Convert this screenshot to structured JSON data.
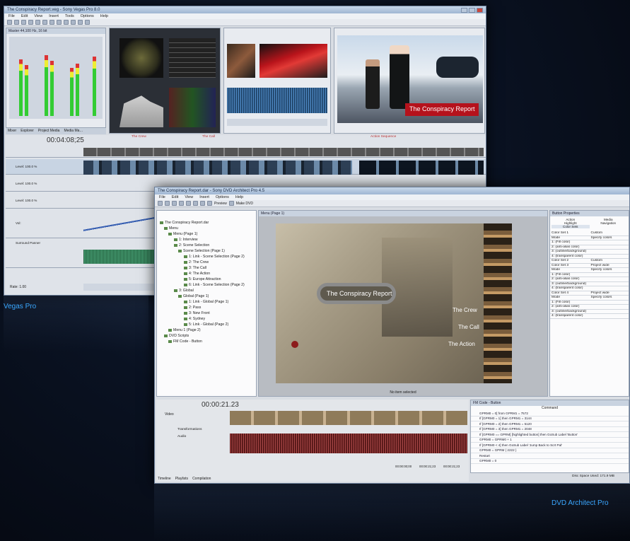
{
  "labels": {
    "vegas": "Vegas Pro",
    "dvda": "DVD Architect Pro"
  },
  "vegas": {
    "title": "The Conspiracy Report.veg - Sony Vegas Pro 8.0",
    "menu": [
      "File",
      "Edit",
      "View",
      "Insert",
      "Tools",
      "Options",
      "Help"
    ],
    "mixer_label": "Master 44,100 Hz, 16 bit",
    "tabs": [
      "Mixer",
      "Explorer",
      "Project Media",
      "Media Ma…"
    ],
    "timecode": "00:04:08;25",
    "preview_title": "The Conspiracy Report",
    "level1": "Level: 100.0 %",
    "level2": "Level: 100.0 %",
    "level3": "Level: 100.0 %",
    "vol": "Vol:",
    "surround": "Surround Panner",
    "rate": "Rate: 1.00",
    "markers": [
      "The Crew",
      "The Call",
      "Action Sequence"
    ]
  },
  "dvda": {
    "title": "The Conspiracy Report.dar - Sony DVD Architect Pro 4.5",
    "menu": [
      "File",
      "Edit",
      "View",
      "Insert",
      "Options",
      "Help"
    ],
    "preview_btn": "Preview",
    "make_dvd_btn": "Make DVD",
    "menu_tab": "Menu (Page 1)",
    "timecode": "00:00:21.23",
    "no_selection": "No item selected",
    "menu_title_text": "The Conspiracy Report",
    "menu_items": [
      "The Crew",
      "The Call",
      "The Action"
    ],
    "tree": [
      "The Conspiracy Report.dar",
      "Menu",
      "Menu (Page 1)",
      "1: Interview",
      "2: Scene Selection",
      "Scene Selection (Page 1)",
      "1: Link - Scene Selection (Page 2)",
      "2: The Crew",
      "3: The Call",
      "4: The Action",
      "5: Europe Attraction",
      "6: Link - Scene Selection (Page 2)",
      "3: Global",
      "Global (Page 1)",
      "1: Link - Global (Page 1)",
      "2: Pass",
      "3: New Front",
      "4: Sydney",
      "5: Link - Global (Page 2)",
      "Menu 1 (Page 2)",
      "DVD Scripts",
      "FM Code - Button"
    ],
    "props_title": "Button Properties",
    "props_cols": [
      "Action",
      "Media",
      "Highlight",
      "Navigation"
    ],
    "props_tab": "Color Sets",
    "props": [
      [
        "Color Set 1",
        "Custom"
      ],
      [
        "Mode",
        "Specify colors"
      ],
      [
        "1: (Fill color)",
        ""
      ],
      [
        "2: (anti-alias color)",
        ""
      ],
      [
        "3: (outline/background)",
        ""
      ],
      [
        "4: (transparent color)",
        ""
      ],
      [
        "Color Set 2",
        "Custom"
      ],
      [
        "Color Set 3",
        "Project wide"
      ],
      [
        "Mode",
        "Specify colors"
      ],
      [
        "1: (Fill color)",
        ""
      ],
      [
        "2: (anti-alias color)",
        ""
      ],
      [
        "3: (outline/background)",
        ""
      ],
      [
        "4: (transparent color)",
        ""
      ],
      [
        "Color Set 4",
        "Project wide"
      ],
      [
        "Mode",
        "Specify colors"
      ],
      [
        "1: (Fill color)",
        ""
      ],
      [
        "2: (anti-alias color)",
        ""
      ],
      [
        "3: (outline/background)",
        ""
      ],
      [
        "4: (transparent color)",
        ""
      ]
    ],
    "script_title": "FM Code - Button",
    "script_header": "Command",
    "commands": [
      "GPRM0 = 0] from GPRM1 = 7572",
      "If [GPRM0 = 1] then GPRM1 = 3144",
      "If [GPRM0 = 2] then GPRM1 = 5120",
      "If [GPRM0 = 3] then GPRM1 = 2048",
      "If [GPRM0 == GPRM] [highlighted button] then GoSub Label 'Button'",
      "GPRM0 = GPRM0 + 1",
      "If [GPRM0 < 4] then GoSub Label 'Jump Back to Scrt Pal'",
      "GPRM0 = GPRM ( 2222 )",
      "Restart",
      "GPRM0 = 0"
    ],
    "bottom_tabs": [
      "Timeline",
      "Playlists",
      "Compilation"
    ],
    "track_labels": [
      "Video",
      "Transformations",
      "Audio"
    ],
    "tc_readouts": [
      "00:00:00;00",
      "00:00:21;23",
      "00:00:21;23"
    ],
    "disc_space": "Disc Space Used: 171.9 MB"
  },
  "colors": {
    "accent": "#3aa7ff",
    "background": "#070b14"
  }
}
